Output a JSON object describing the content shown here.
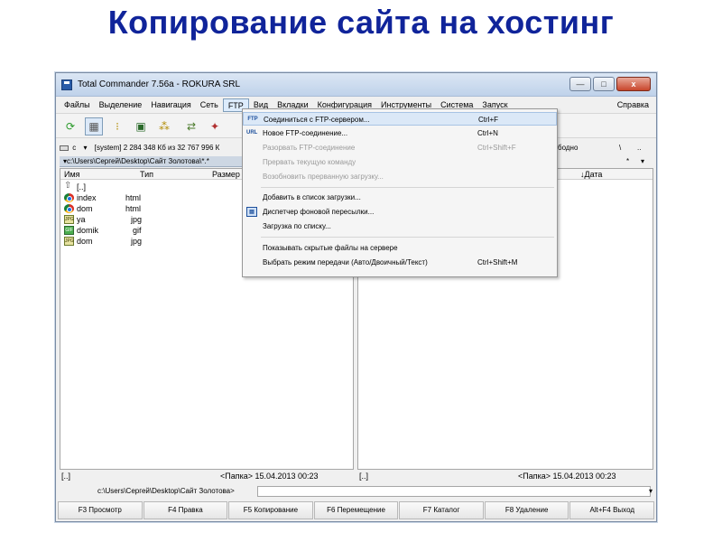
{
  "slide": {
    "title": "Копирование сайта на хостинг"
  },
  "window": {
    "title": "Total Commander 7.56a - ROKURA SRL",
    "buttons": {
      "minimize": "—",
      "maximize": "□",
      "close": "x"
    }
  },
  "menu": {
    "items": [
      "Файлы",
      "Выделение",
      "Навигация",
      "Сеть",
      "FTP",
      "Вид",
      "Вкладки",
      "Конфигурация",
      "Инструменты",
      "Система",
      "Запуск"
    ],
    "active": "FTP",
    "help": "Справка"
  },
  "left_panel": {
    "drive": "c",
    "drive_info": "[system]  2 284 348 Кб из 32 767 996 К",
    "path": "▾c:\\Users\\Сергей\\Desktop\\Сайт Золотова\\*.*",
    "columns": {
      "name": "Имя",
      "type": "Тип",
      "size": "Размер"
    },
    "files": [
      {
        "icon": "parent-dir-icon",
        "name": "[..]",
        "ext": ""
      },
      {
        "icon": "html-file-icon",
        "name": "index",
        "ext": "html"
      },
      {
        "icon": "html-file-icon",
        "name": "dom",
        "ext": "html"
      },
      {
        "icon": "jpg-file-icon",
        "name": "ya",
        "ext": "jpg"
      },
      {
        "icon": "gif-file-icon",
        "name": "domik",
        "ext": "gif"
      },
      {
        "icon": "jpg-file-icon",
        "name": "dom",
        "ext": "jpg"
      }
    ],
    "status_name": "[..]",
    "status_info": "<Папка>  15.04.2013 00:23"
  },
  "right_panel": {
    "drive_info": "бодно",
    "drive_sym": "\\",
    "drive_sym2": "..",
    "star": "*",
    "columns": {
      "date": "↓Дата"
    },
    "status_name": "[..]",
    "status_info": "<Папка>  15.04.2013 00:23"
  },
  "command_line": {
    "prompt": "c:\\Users\\Сергей\\Desktop\\Сайт Золотова>"
  },
  "function_keys": [
    "F3 Просмотр",
    "F4 Правка",
    "F5 Копирование",
    "F6 Перемещение",
    "F7 Каталог",
    "F8 Удаление",
    "Alt+F4 Выход"
  ],
  "ftp_menu": {
    "items": [
      {
        "label": "Соединиться с FTP-сервером...",
        "shortcut": "Ctrl+F",
        "icon": "ftp-connect-icon",
        "disabled": false,
        "highlight": true
      },
      {
        "label": "Новое FTP-соединение...",
        "shortcut": "Ctrl+N",
        "icon": "ftp-new-connection-icon",
        "disabled": false
      },
      {
        "label": "Разорвать FTP-соединение",
        "shortcut": "Ctrl+Shift+F",
        "disabled": true
      },
      {
        "label": "Прервать текущую команду",
        "shortcut": "",
        "disabled": true
      },
      {
        "label": "Возобновить прерванную загрузку...",
        "shortcut": "",
        "disabled": true
      },
      {
        "label": "Добавить в список загрузки...",
        "shortcut": "",
        "disabled": false
      },
      {
        "label": "Диспетчер фоновой пересылки...",
        "shortcut": "",
        "icon": "background-transfer-icon",
        "disabled": false
      },
      {
        "label": "Загрузка по списку...",
        "shortcut": "",
        "disabled": false
      },
      {
        "label": "Показывать скрытые файлы на сервере",
        "shortcut": "",
        "disabled": false
      },
      {
        "label": "Выбрать режим передачи (Авто/Двоичный/Текст)",
        "shortcut": "Ctrl+Shift+M",
        "disabled": false
      }
    ]
  }
}
